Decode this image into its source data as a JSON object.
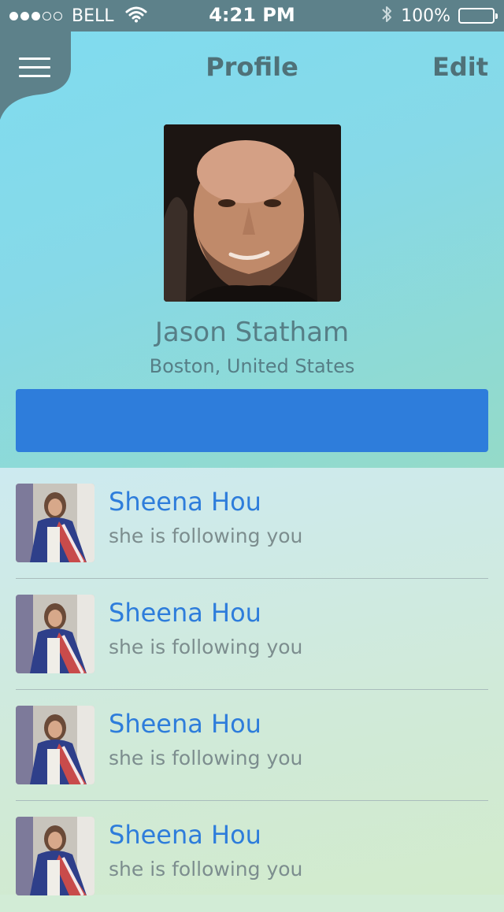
{
  "status_bar": {
    "carrier": "BELL",
    "time": "4:21 PM",
    "battery": "100%"
  },
  "nav": {
    "title": "Profile",
    "edit_label": "Edit"
  },
  "profile": {
    "name": "Jason Statham",
    "location": "Boston, United States"
  },
  "followers": [
    {
      "name": "Sheena Hou",
      "status": "she is following you"
    },
    {
      "name": "Sheena Hou",
      "status": "she is following you"
    },
    {
      "name": "Sheena Hou",
      "status": "she is following you"
    },
    {
      "name": "Sheena Hou",
      "status": "she is following you"
    }
  ],
  "colors": {
    "status_bar_bg": "#5d818a",
    "accent_blue": "#2e7ddb",
    "title_text": "#4f7178"
  },
  "icons": [
    "signal-dots-icon",
    "wifi-icon",
    "bluetooth-icon",
    "battery-icon",
    "menu-icon"
  ]
}
